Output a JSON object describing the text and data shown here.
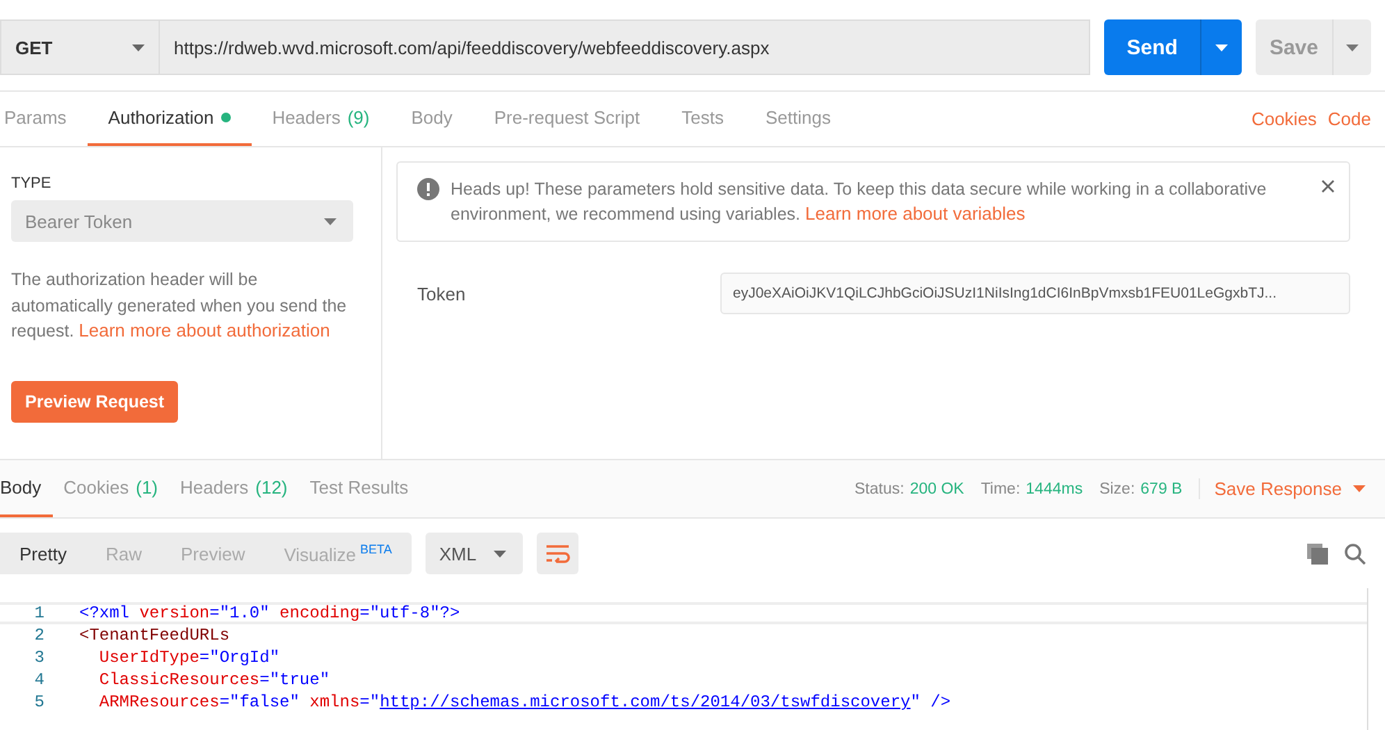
{
  "request": {
    "method": "GET",
    "url": "https://rdweb.wvd.microsoft.com/api/feeddiscovery/webfeeddiscovery.aspx",
    "send": "Send",
    "save": "Save"
  },
  "request_tabs": [
    {
      "label": "Params",
      "selected": false,
      "indicator": false
    },
    {
      "label": "Authorization",
      "selected": true,
      "indicator": true
    },
    {
      "label": "Headers",
      "count": "(9)",
      "selected": false,
      "indicator": false
    },
    {
      "label": "Body",
      "selected": false,
      "indicator": false
    },
    {
      "label": "Pre-request Script",
      "selected": false,
      "indicator": false
    },
    {
      "label": "Tests",
      "selected": false,
      "indicator": false
    },
    {
      "label": "Settings",
      "selected": false,
      "indicator": false
    }
  ],
  "request_links": [
    "Cookies",
    "Code"
  ],
  "auth": {
    "type_label": "TYPE",
    "type": "Bearer Token",
    "help": "The authorization header will be automatically generated when you send the request.",
    "help_link": "Learn more about authorization",
    "preview": "Preview Request",
    "notice": "Heads up! These parameters hold sensitive data. To keep this data secure while working in a collaborative environment, we recommend using variables.",
    "notice_link": "Learn more about variables",
    "token_label": "Token",
    "token": "eyJ0eXAiOiJKV1QiLCJhbGciOiJSUzI1NiIsIng1dCI6InBpVmxsb1FEU01LeGgxbTJ..."
  },
  "response_tabs": [
    {
      "label": "Body",
      "selected": true
    },
    {
      "label": "Cookies",
      "count": "(1)",
      "selected": false
    },
    {
      "label": "Headers",
      "count": "(12)",
      "selected": false
    },
    {
      "label": "Test Results",
      "selected": false
    }
  ],
  "status": [
    {
      "label": "Status:",
      "value": "200 OK"
    },
    {
      "label": "Time:",
      "value": "1444ms"
    },
    {
      "label": "Size:",
      "value": "679 B"
    }
  ],
  "save_response": "Save Response",
  "view_modes": [
    {
      "label": "Pretty",
      "selected": true
    },
    {
      "label": "Raw",
      "selected": false
    },
    {
      "label": "Preview",
      "selected": false
    },
    {
      "label": "Visualize",
      "badge": "BETA",
      "selected": false
    }
  ],
  "format": "XML",
  "code": [
    {
      "number": "1",
      "tokens": [
        {
          "kind": "punct",
          "text": "<?xml"
        },
        {
          "kind": "attr",
          "text": " version"
        },
        {
          "kind": "punct",
          "text": "="
        },
        {
          "kind": "value",
          "text": "\"1.0\""
        },
        {
          "kind": "attr",
          "text": " encoding"
        },
        {
          "kind": "punct",
          "text": "="
        },
        {
          "kind": "value",
          "text": "\"utf-8\"?>"
        }
      ]
    },
    {
      "number": "2",
      "tokens": [
        {
          "kind": "tag",
          "text": "<TenantFeedURLs"
        }
      ]
    },
    {
      "number": "3",
      "tokens": [
        {
          "kind": "attr",
          "text": "  UserIdType"
        },
        {
          "kind": "punct",
          "text": "="
        },
        {
          "kind": "value",
          "text": "\"OrgId\""
        }
      ]
    },
    {
      "number": "4",
      "tokens": [
        {
          "kind": "attr",
          "text": "  ClassicResources"
        },
        {
          "kind": "punct",
          "text": "="
        },
        {
          "kind": "value",
          "text": "\"true\""
        }
      ]
    },
    {
      "number": "5",
      "tokens": [
        {
          "kind": "attr",
          "text": "  ARMResources"
        },
        {
          "kind": "punct",
          "text": "="
        },
        {
          "kind": "value",
          "text": "\"false\""
        },
        {
          "kind": "attr",
          "text": " xmlns"
        },
        {
          "kind": "punct",
          "text": "="
        },
        {
          "kind": "value",
          "text": "\""
        },
        {
          "kind": "link",
          "text": "http://schemas.microsoft.com/ts/2014/03/tswfdiscovery"
        },
        {
          "kind": "value",
          "text": "\""
        },
        {
          "kind": "punct",
          "text": " />"
        }
      ]
    }
  ]
}
